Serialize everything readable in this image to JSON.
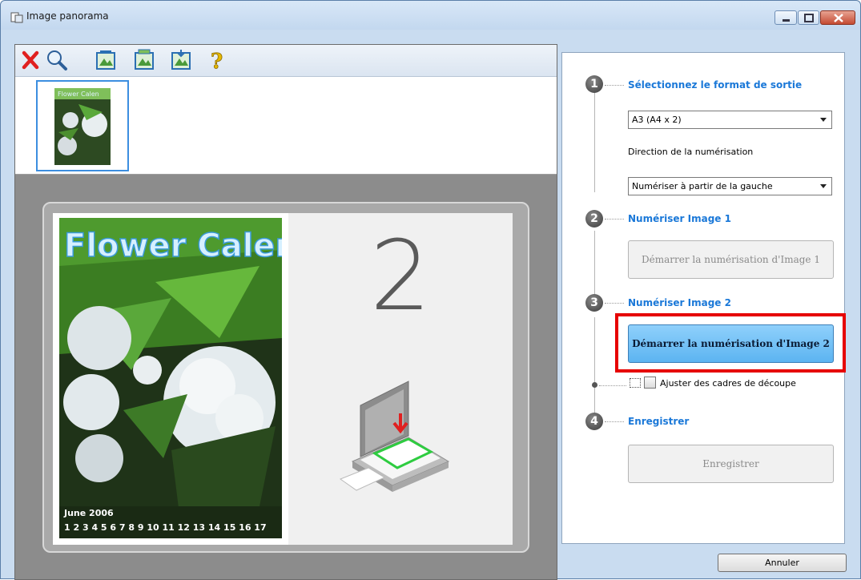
{
  "window": {
    "title": "Image panorama",
    "icons": [
      "window-icon",
      "minimize-icon",
      "maximize-icon",
      "close-icon"
    ]
  },
  "toolbar": {
    "buttons": [
      "delete-icon",
      "zoom-icon",
      "scan-image-icon",
      "scan-image-2-icon",
      "save-image-icon",
      "help-icon"
    ]
  },
  "preview": {
    "slot2_number": "2",
    "photo_title": "Flower Calenc",
    "calendar_month": "June 2006",
    "calendar_days": "1 2 3 4 5 6 7 8 9 10 11 12 13 14 15 16 17"
  },
  "steps": {
    "step1": {
      "number": "1",
      "title": "Sélectionnez le format de sortie",
      "format_value": "A3 (A4 x 2)",
      "direction_label": "Direction de la numérisation",
      "direction_value": "Numériser à partir de la gauche"
    },
    "step2": {
      "number": "2",
      "title": "Numériser Image 1",
      "button_label": "Démarrer la numérisation d'Image 1"
    },
    "step3": {
      "number": "3",
      "title": "Numériser Image 2",
      "button_label": "Démarrer la numérisation d'Image 2",
      "checkbox_label": "Ajuster des cadres de découpe"
    },
    "step4": {
      "number": "4",
      "title": "Enregistrer",
      "button_label": "Enregistrer"
    }
  },
  "footer": {
    "cancel_label": "Annuler"
  },
  "colors": {
    "accent": "#1a78d8",
    "highlight": "#e60000",
    "primary_button": "#5cb4f1"
  }
}
